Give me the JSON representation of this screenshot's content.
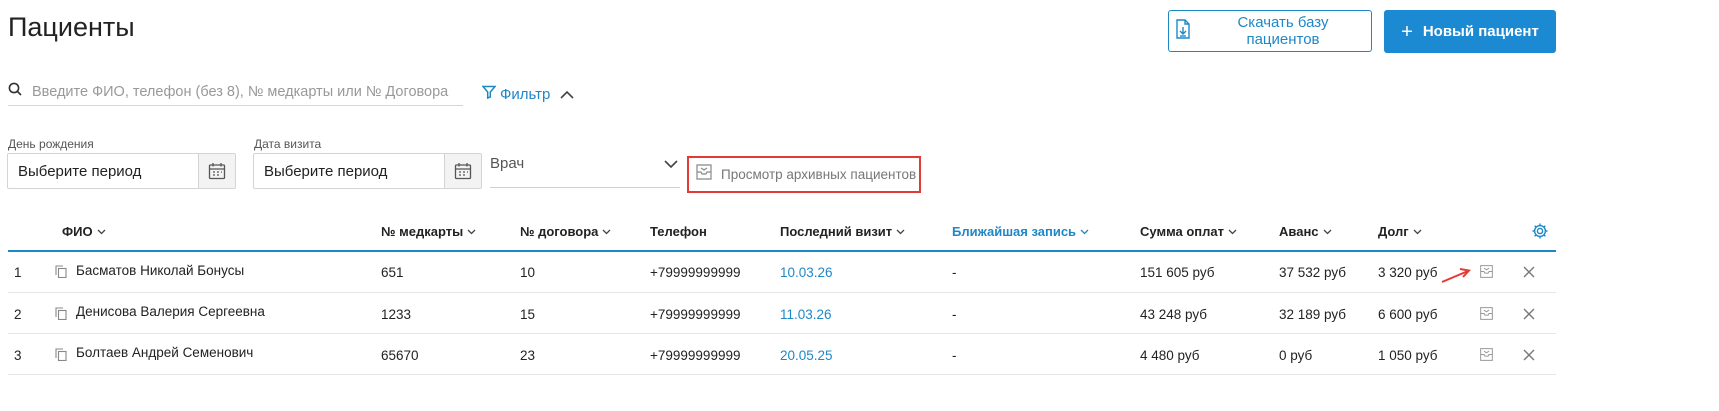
{
  "page": {
    "title": "Пациенты"
  },
  "header": {
    "download_label": "Скачать базу пациентов",
    "new_patient_plus": "+",
    "new_patient_label": "Новый пациент"
  },
  "search": {
    "placeholder": "Введите ФИО, телефон (без 8), № медкарты или № Договора",
    "value": ""
  },
  "filter": {
    "label": "Фильтр",
    "expanded": true
  },
  "filters": {
    "birthday": {
      "label": "День рождения",
      "value": "Выберите период"
    },
    "visit_date": {
      "label": "Дата визита",
      "value": "Выберите период"
    },
    "doctor": {
      "label": "Врач"
    },
    "archive_label": "Просмотр архивных пациентов"
  },
  "table": {
    "columns": [
      {
        "key": "name",
        "label": "ФИО",
        "sortable": true
      },
      {
        "key": "card",
        "label": "№ медкарты",
        "sortable": true
      },
      {
        "key": "contract",
        "label": "№ договора",
        "sortable": true
      },
      {
        "key": "phone",
        "label": "Телефон",
        "sortable": false
      },
      {
        "key": "last_visit",
        "label": "Последний визит",
        "sortable": true
      },
      {
        "key": "next_appt",
        "label": "Ближайшая запись",
        "sortable": true,
        "active": true
      },
      {
        "key": "payments",
        "label": "Сумма оплат",
        "sortable": true
      },
      {
        "key": "advance",
        "label": "Аванс",
        "sortable": true
      },
      {
        "key": "debt",
        "label": "Долг",
        "sortable": true
      }
    ],
    "rows": [
      {
        "num": "1",
        "name": "Басматов Николай Бонусы",
        "card": "651",
        "contract": "10",
        "phone": "+79999999999",
        "last_visit": "10.03.26",
        "next_appt": "-",
        "payments": "151 605 руб",
        "advance": "37 532 руб",
        "debt": "3 320 руб"
      },
      {
        "num": "2",
        "name": "Денисова Валерия Сергеевна",
        "card": "1233",
        "contract": "15",
        "phone": "+79999999999",
        "last_visit": "11.03.26",
        "next_appt": "-",
        "payments": "43 248 руб",
        "advance": "32 189 руб",
        "debt": "6 600 руб"
      },
      {
        "num": "3",
        "name": "Болтаев Андрей Семенович",
        "card": "65670",
        "contract": "23",
        "phone": "+79999999999",
        "last_visit": "20.05.25",
        "next_appt": "-",
        "payments": "4 480 руб",
        "advance": "0 руб",
        "debt": "1 050 руб"
      }
    ]
  },
  "colors": {
    "accent": "#1e88c7",
    "primary_button": "#1b8ad3",
    "highlight_box": "#e53935",
    "annotation_arrow": "#e53935"
  },
  "icons": {
    "download": "download-file-icon",
    "search": "search-icon",
    "filter": "filter-funnel-icon",
    "chevron_up": "chevron-up-icon",
    "calendar": "calendar-icon",
    "chevron_down": "chevron-down-icon",
    "archive": "archive-icon",
    "settings": "gear-icon",
    "copy": "copy-icon",
    "delete": "close-icon"
  }
}
